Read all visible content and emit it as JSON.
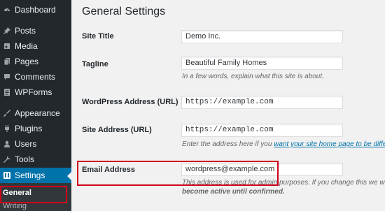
{
  "sidebar": {
    "items": [
      {
        "label": "Dashboard",
        "icon": "dashboard-icon"
      },
      {
        "label": "Posts",
        "icon": "pushpin-icon"
      },
      {
        "label": "Media",
        "icon": "media-icon"
      },
      {
        "label": "Pages",
        "icon": "pages-icon"
      },
      {
        "label": "Comments",
        "icon": "comment-icon"
      },
      {
        "label": "WPForms",
        "icon": "forms-icon"
      },
      {
        "label": "Appearance",
        "icon": "paintbrush-icon"
      },
      {
        "label": "Plugins",
        "icon": "plugin-icon"
      },
      {
        "label": "Users",
        "icon": "users-icon"
      },
      {
        "label": "Tools",
        "icon": "wrench-icon"
      },
      {
        "label": "Settings",
        "icon": "settings-icon"
      }
    ],
    "submenu": {
      "general": "General",
      "writing": "Writing"
    }
  },
  "main": {
    "title": "General Settings",
    "fields": {
      "site_title": {
        "label": "Site Title",
        "value": "Demo Inc."
      },
      "tagline": {
        "label": "Tagline",
        "value": "Beautiful Family Homes",
        "desc": "In a few words, explain what this site is about."
      },
      "wp_address": {
        "label": "WordPress Address (URL)",
        "value": "https://example.com"
      },
      "site_address": {
        "label": "Site Address (URL)",
        "value": "https://example.com",
        "desc_before": "Enter the address here if you ",
        "desc_link": "want your site home page to be diffe"
      },
      "email": {
        "label": "Email Address",
        "value": "wordpress@example.com",
        "desc_line1": "This address is used for admin purposes. If you change this we w",
        "desc_line2": "become active until confirmed."
      }
    }
  },
  "colors": {
    "sidebar": "#23282d",
    "accent": "#0073aa",
    "highlight": "#d0021b"
  }
}
